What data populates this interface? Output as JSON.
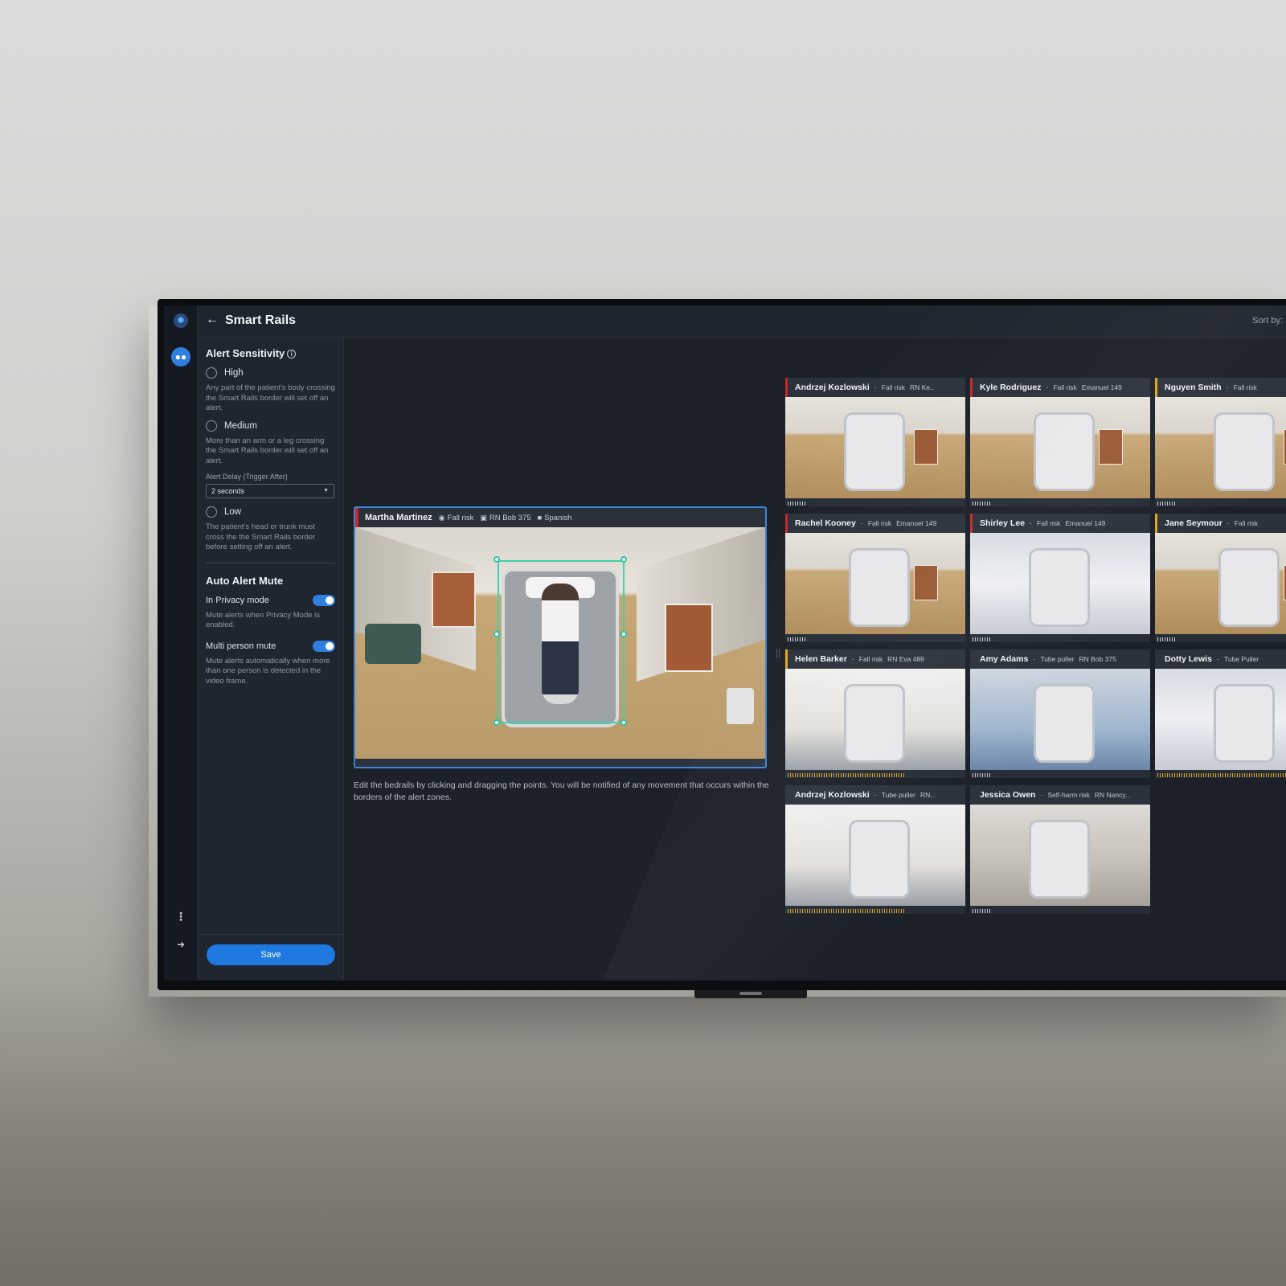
{
  "app": {
    "title": "Smart Rails",
    "sort_label": "Sort by:"
  },
  "rail": {
    "logo_icon": "camera-logo-icon",
    "patients_icon": "people-icon",
    "more_icon": "more-vertical-icon",
    "logout_icon": "logout-icon"
  },
  "settings": {
    "alert_sensitivity_title": "Alert Sensitivity",
    "options": [
      {
        "label": "High",
        "desc": "Any part of the patient's body crossing the Smart Rails border will set off an alert."
      },
      {
        "label": "Medium",
        "desc": "More than an arm or a leg crossing the Smart Rails border will set off an alert."
      },
      {
        "label": "Low",
        "desc": "The patient's head or trunk must cross the the Smart Rails border before setting off an alert."
      }
    ],
    "delay_label": "Alert Delay (Trigger After)",
    "delay_value": "2 seconds",
    "auto_mute_title": "Auto Alert Mute",
    "toggles": [
      {
        "label": "In Privacy mode",
        "desc": "Mute alerts when Privacy Mode is enabled.",
        "on": true
      },
      {
        "label": "Multi person mute",
        "desc": "Mute alerts automatically when more than one person is detected in the video frame.",
        "on": true
      }
    ],
    "save_label": "Save"
  },
  "editor": {
    "patient": "Martha Martinez",
    "risk": "Fall risk",
    "nurse": "RN Bob 375",
    "language": "Spanish",
    "hint": "Edit the bedrails by clicking and dragging the points. You will be notified of any movement that occurs within the borders of the alert zones.",
    "colors": {
      "alert": "#c62a2a",
      "rail": "#3fd1b0",
      "accent": "#2e7fe0"
    }
  },
  "tiles": [
    {
      "name": "Andrzej Kozlowski",
      "risk": "Fall risk",
      "meta": "RN Ke..",
      "flag": "red",
      "meter": 0.1,
      "hot": false
    },
    {
      "name": "Kyle Rodriguez",
      "risk": "Fall risk",
      "meta": "Emanuel 149",
      "flag": "red",
      "meter": 0.1,
      "hot": false
    },
    {
      "name": "Nguyen Smith",
      "risk": "Fall risk",
      "meta": "",
      "flag": "yellow",
      "meter": 0.1,
      "hot": false
    },
    {
      "name": "Rachel Kooney",
      "risk": "Fall risk",
      "meta": "Emanuel 149",
      "flag": "red",
      "meter": 0.1,
      "hot": false
    },
    {
      "name": "Shirley Lee",
      "risk": "Fall risk",
      "meta": "Emanuel 149",
      "flag": "red",
      "meter": 0.1,
      "hot": false
    },
    {
      "name": "Jane Seymour",
      "risk": "Fall risk",
      "meta": "",
      "flag": "yellow",
      "meter": 0.1,
      "hot": false
    },
    {
      "name": "Helen Barker",
      "risk": "Fall risk",
      "meta": "RN Eva 489",
      "flag": "yellow",
      "meter": 0.67,
      "hot": true
    },
    {
      "name": "Amy Adams",
      "risk": "Tube puller",
      "meta": "RN Bob 375",
      "flag": "none",
      "meter": 0.1,
      "hot": false
    },
    {
      "name": "Dotty Lewis",
      "risk": "Tube Puller",
      "meta": "",
      "flag": "none",
      "meter": 1.0,
      "hot": true
    },
    {
      "name": "Andrzej Kozlowski",
      "risk": "Tube puller",
      "meta": "RN...",
      "flag": "none",
      "meter": 0.67,
      "hot": true
    },
    {
      "name": "Jessica Owen",
      "risk": "Self-harm risk",
      "meta": "RN Nancy...",
      "flag": "none",
      "meter": 0.1,
      "hot": false
    }
  ]
}
